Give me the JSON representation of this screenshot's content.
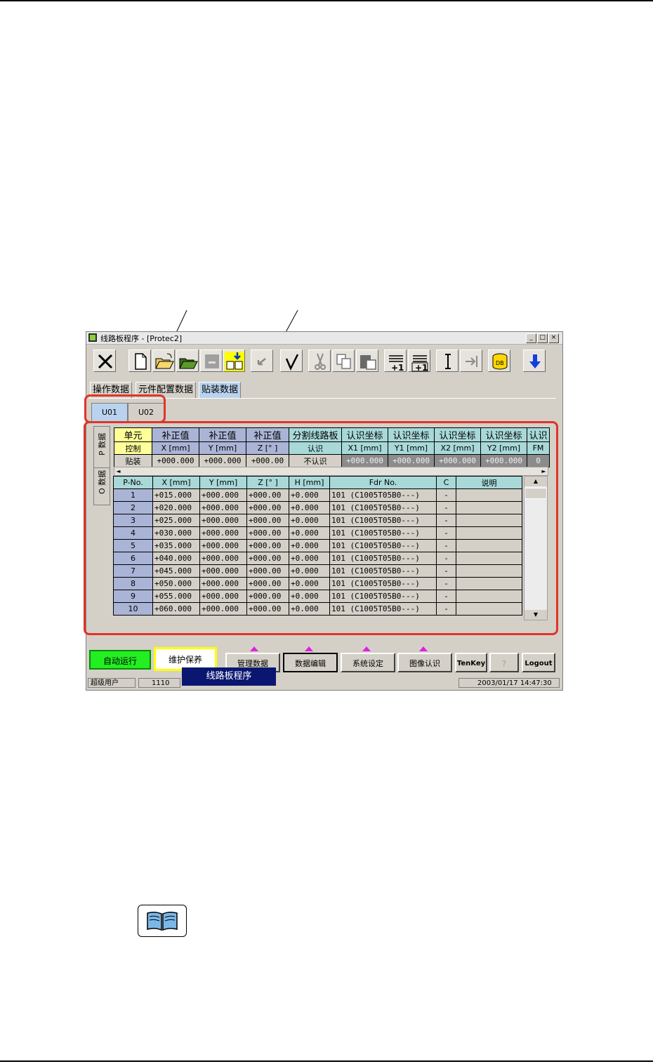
{
  "window": {
    "title": "线路板程序 - [Protec2]",
    "controls": [
      "_",
      "□",
      "×"
    ]
  },
  "toolbar": {
    "icons": [
      "close-x-icon",
      "new-file-icon",
      "open-folder-icon",
      "open-folder-2-icon",
      "save-disabled-icon",
      "save-as-icon",
      "undo-icon",
      "check-icon",
      "cut-icon",
      "copy-icon",
      "paste-icon",
      "insert-row-plus-icon",
      "add-row-plus-icon",
      "cursor-i-icon",
      "goto-end-icon",
      "db-icon",
      "down-arrow-icon"
    ],
    "plus_one": "+1"
  },
  "tabs": [
    "操作数据",
    "元件配置数据",
    "贴装数据"
  ],
  "unit_tabs": [
    "U01",
    "U02"
  ],
  "side_tabs": [
    "P 数据",
    "O 数据"
  ],
  "header_grid": {
    "cols": [
      {
        "l1": "单元",
        "l2": "控制",
        "value": "贴装",
        "style": "yellow"
      },
      {
        "l1": "补正值",
        "l2": "X [mm]",
        "value": "+000.000",
        "style": "blue"
      },
      {
        "l1": "补正值",
        "l2": "Y [mm]",
        "value": "+000.000",
        "style": "blue"
      },
      {
        "l1": "补正值",
        "l2": "Z [° ]",
        "value": "+000.00",
        "style": "blue"
      },
      {
        "l1": "分割线路板",
        "l2": "认识",
        "value": "不认识",
        "style": "teal"
      },
      {
        "l1": "认识坐标",
        "l2": "X1 [mm]",
        "value": "+000.000",
        "style": "teal",
        "dark": true
      },
      {
        "l1": "认识坐标",
        "l2": "Y1 [mm]",
        "value": "+000.000",
        "style": "teal",
        "dark": true
      },
      {
        "l1": "认识坐标",
        "l2": "X2 [mm]",
        "value": "+000.000",
        "style": "teal",
        "dark": true
      },
      {
        "l1": "认识坐标",
        "l2": "Y2 [mm]",
        "value": "+000.000",
        "style": "teal",
        "dark": true
      },
      {
        "l1": "认识",
        "l2": "FM",
        "value": "0",
        "style": "teal",
        "dark": true
      }
    ]
  },
  "data_grid": {
    "headers": [
      "P-No.",
      "X [mm]",
      "Y [mm]",
      "Z [° ]",
      "H [mm]",
      "Fdr No.",
      "C",
      "说明"
    ],
    "rows": [
      [
        "1",
        "+015.000",
        "+000.000",
        "+000.00",
        "+0.000",
        "101  (C1005T05B0---)",
        "-",
        ""
      ],
      [
        "2",
        "+020.000",
        "+000.000",
        "+000.00",
        "+0.000",
        "101  (C1005T05B0---)",
        "-",
        ""
      ],
      [
        "3",
        "+025.000",
        "+000.000",
        "+000.00",
        "+0.000",
        "101  (C1005T05B0---)",
        "-",
        ""
      ],
      [
        "4",
        "+030.000",
        "+000.000",
        "+000.00",
        "+0.000",
        "101  (C1005T05B0---)",
        "-",
        ""
      ],
      [
        "5",
        "+035.000",
        "+000.000",
        "+000.00",
        "+0.000",
        "101  (C1005T05B0---)",
        "-",
        ""
      ],
      [
        "6",
        "+040.000",
        "+000.000",
        "+000.00",
        "+0.000",
        "101  (C1005T05B0---)",
        "-",
        ""
      ],
      [
        "7",
        "+045.000",
        "+000.000",
        "+000.00",
        "+0.000",
        "101  (C1005T05B0---)",
        "-",
        ""
      ],
      [
        "8",
        "+050.000",
        "+000.000",
        "+000.00",
        "+0.000",
        "101  (C1005T05B0---)",
        "-",
        ""
      ],
      [
        "9",
        "+055.000",
        "+000.000",
        "+000.00",
        "+0.000",
        "101  (C1005T05B0---)",
        "-",
        ""
      ],
      [
        "10",
        "+060.000",
        "+000.000",
        "+000.00",
        "+0.000",
        "101  (C1005T05B0---)",
        "-",
        ""
      ]
    ]
  },
  "bottom_bar": {
    "auto_run": "自动运行",
    "maintenance": "维护保养",
    "popup": "线路板程序",
    "buttons": [
      "管理数据",
      "数据编辑",
      "系统设定",
      "图像认识"
    ],
    "tenkey": "TenKey",
    "help": "?",
    "logout": "Logout"
  },
  "status_bar": {
    "user": "超级用户",
    "code": "1110",
    "datetime": "2003/01/17 14:47:30"
  },
  "colors": {
    "highlight_red": "#e0342a",
    "auto_run_green": "#22ee22",
    "maint_yellow": "#ffff00",
    "popup_navy": "#0a1670",
    "marker_magenta": "#e020e0"
  },
  "page_icons": [
    "book-icon"
  ]
}
